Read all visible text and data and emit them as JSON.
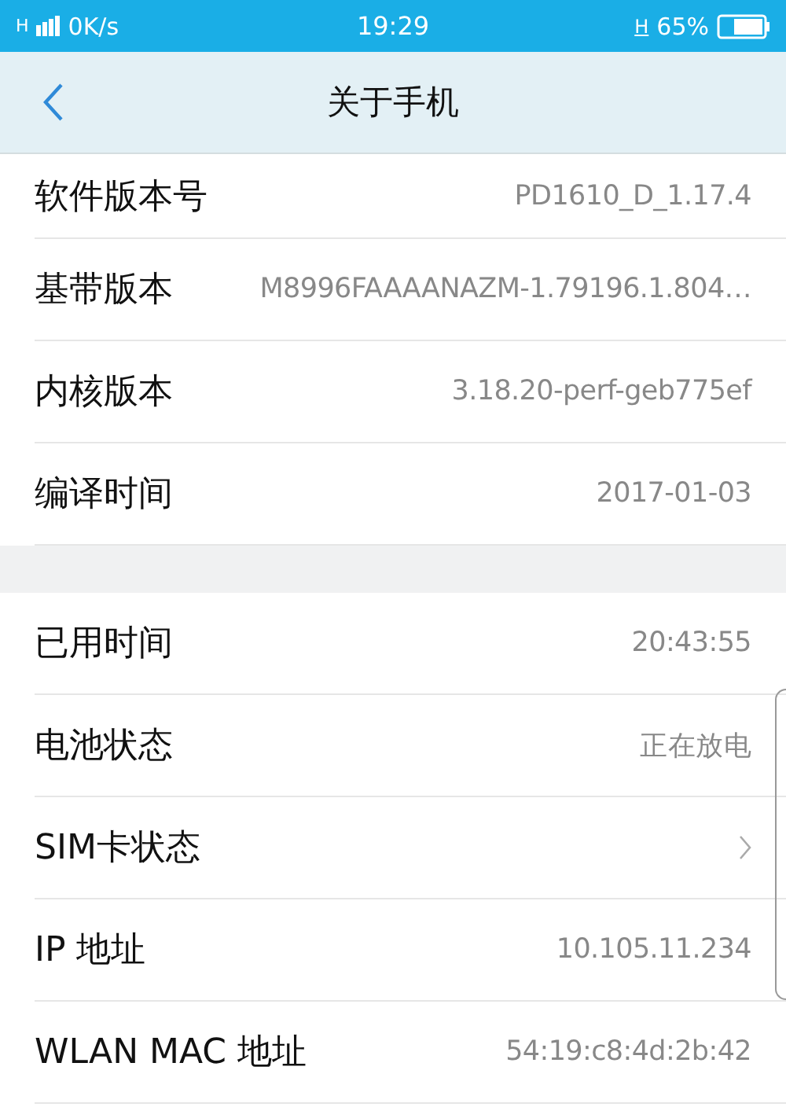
{
  "status_bar": {
    "network": "H",
    "speed": "0K/s",
    "time": "19:29",
    "data_type": "H",
    "battery": "65%"
  },
  "header": {
    "title": "关于手机"
  },
  "sections": [
    {
      "rows": [
        {
          "kind": "value",
          "label": "软件版本号",
          "value": "PD1610_D_1.17.4"
        },
        {
          "kind": "value",
          "label": "基带版本",
          "value": "M8996FAAAANAZM-1.79196.1.804…"
        },
        {
          "kind": "value",
          "label": "内核版本",
          "value": "3.18.20-perf-geb775ef"
        },
        {
          "kind": "value",
          "label": "编译时间",
          "value": "2017-01-03"
        }
      ]
    },
    {
      "rows": [
        {
          "kind": "value",
          "label": "已用时间",
          "value": "20:43:55"
        },
        {
          "kind": "value",
          "label": "电池状态",
          "value": "正在放电"
        },
        {
          "kind": "link",
          "label": "SIM卡状态"
        },
        {
          "kind": "value",
          "label": "IP 地址",
          "value": "10.105.11.234"
        },
        {
          "kind": "value",
          "label": "WLAN MAC 地址",
          "value": "54:19:c8:4d:2b:42"
        }
      ]
    }
  ]
}
